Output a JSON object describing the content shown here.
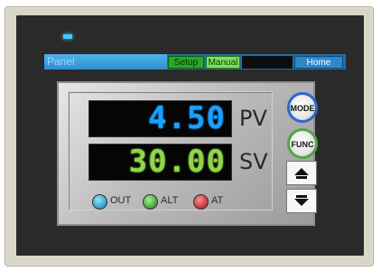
{
  "titlebar": {
    "panel_label": "Panel",
    "tabs": {
      "setup": "Setup",
      "manual": "Manual",
      "home": "Home"
    }
  },
  "controller": {
    "pv": {
      "value": "4.50",
      "unit": "PV"
    },
    "sv": {
      "value": "30.00",
      "unit": "SV"
    },
    "indicators": {
      "out": "OUT",
      "alt": "ALT",
      "at": "AT"
    },
    "buttons": {
      "mode": "MODE",
      "func": "FUNC"
    }
  },
  "colors": {
    "pv_digits": "#1aa0ff",
    "sv_digits": "#8fd64a",
    "mode_ring": "#2f67c9",
    "func_ring": "#52a44a"
  },
  "icons": {
    "status_led": "status-led",
    "up": "arrow-up-icon",
    "down": "arrow-down-icon"
  }
}
